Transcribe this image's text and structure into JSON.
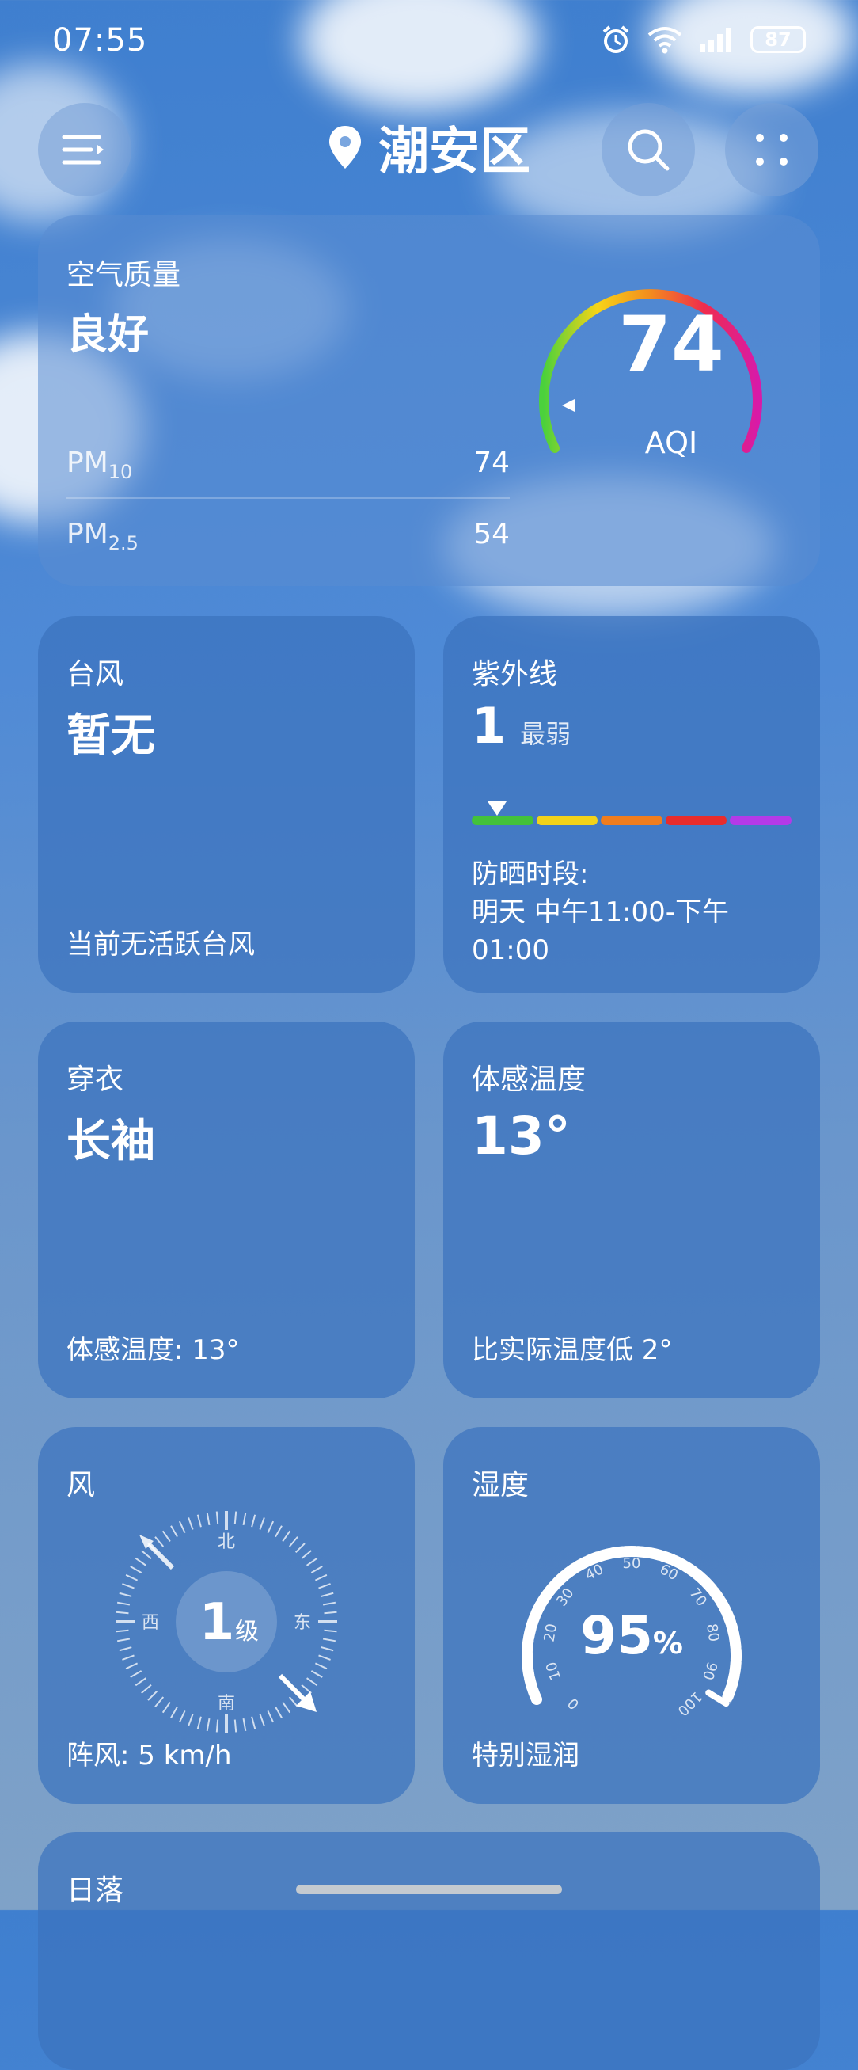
{
  "status": {
    "time": "07:55",
    "battery": "87"
  },
  "header": {
    "location": "潮安区"
  },
  "air_quality": {
    "title": "空气质量",
    "level": "良好",
    "pm10_label": "PM",
    "pm10_sub": "10",
    "pm10_value": "74",
    "pm25_label": "PM",
    "pm25_sub": "2.5",
    "pm25_value": "54",
    "aqi_value": "74",
    "aqi_label": "AQI"
  },
  "typhoon": {
    "title": "台风",
    "value": "暂无",
    "subtitle": "当前无活跃台风"
  },
  "uv": {
    "title": "紫外线",
    "value": "1",
    "level": "最弱",
    "sun_label": "防晒时段:",
    "sun_time_1": "明天 中午11:00-下午",
    "sun_time_2": "01:00",
    "colors": [
      "#43c23b",
      "#f2d21a",
      "#f07d1e",
      "#e82c2c",
      "#b43ae8"
    ],
    "level_fraction": 0.08
  },
  "clothing": {
    "title": "穿衣",
    "value": "长袖",
    "subtitle": "体感温度: 13°"
  },
  "feels_like": {
    "title": "体感温度",
    "value": "13°",
    "subtitle": "比实际温度低 2°"
  },
  "wind": {
    "title": "风",
    "level_num": "1",
    "level_unit": "级",
    "dir_n": "北",
    "dir_s": "南",
    "dir_e": "东",
    "dir_w": "西",
    "subtitle": "阵风: 5 km/h"
  },
  "humidity": {
    "title": "湿度",
    "value": "95",
    "unit": "%",
    "subtitle": "特别湿润",
    "ticks": [
      "0",
      "10",
      "20",
      "30",
      "40",
      "50",
      "60",
      "70",
      "80",
      "90",
      "100"
    ]
  },
  "sunset": {
    "title": "日落"
  }
}
